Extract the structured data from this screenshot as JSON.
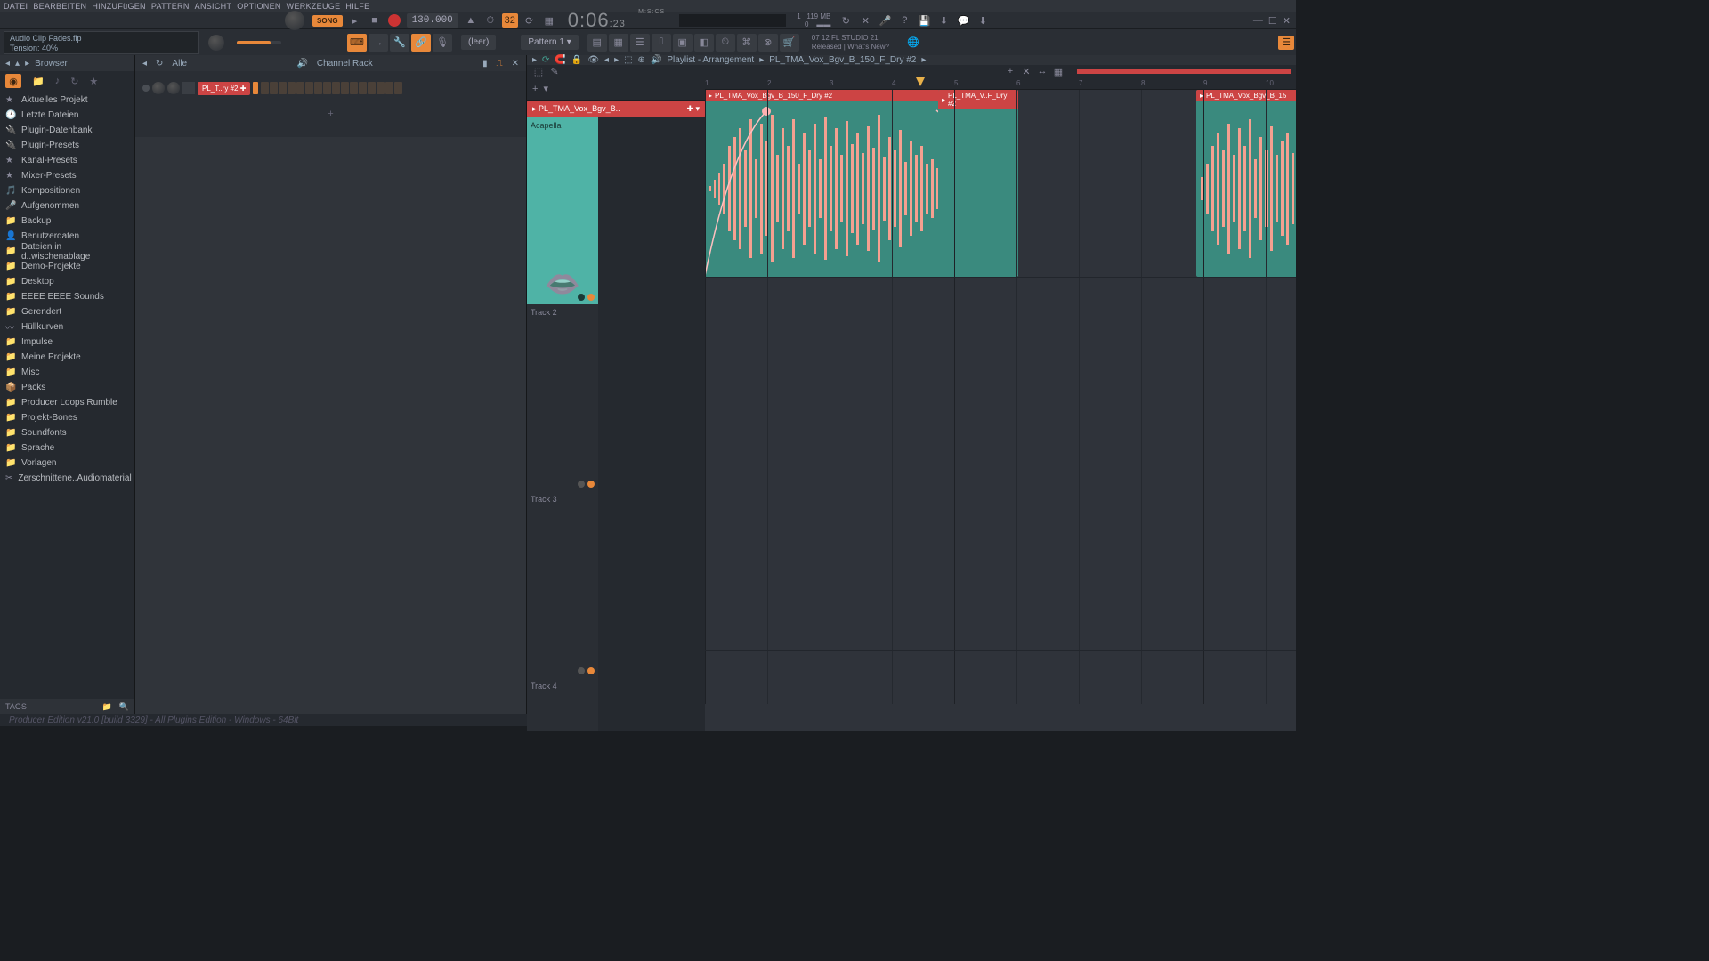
{
  "menu": [
    "DATEI",
    "BEARBEITEN",
    "HINZUFüGEN",
    "PATTERN",
    "ANSICHT",
    "OPTIONEN",
    "WERKZEUGE",
    "HILFE"
  ],
  "hint": {
    "line1": "Audio Clip Fades.flp",
    "line2": "Tension:  40%"
  },
  "transport": {
    "song_label": "SONG",
    "tempo": "130.000",
    "snap": "32",
    "time_main": "0:06",
    "time_sub": ":23",
    "time_unit": "M:S:CS"
  },
  "sys": {
    "voices": "1",
    "mem": "119 MB",
    "cpu": "0"
  },
  "info": {
    "line1": "07 12  FL STUDIO 21",
    "line2": "Released | What's New?"
  },
  "pattern": {
    "label": "Pattern 1",
    "dropdown_prefix": "(leer)"
  },
  "browser": {
    "title": "Browser",
    "filter": "Alle",
    "items": [
      {
        "icon": "★",
        "label": "Aktuelles Projekt"
      },
      {
        "icon": "🕐",
        "label": "Letzte Dateien"
      },
      {
        "icon": "🔌",
        "label": "Plugin-Datenbank"
      },
      {
        "icon": "🔌",
        "label": "Plugin-Presets"
      },
      {
        "icon": "★",
        "label": "Kanal-Presets"
      },
      {
        "icon": "★",
        "label": "Mixer-Presets"
      },
      {
        "icon": "🎵",
        "label": "Kompositionen"
      },
      {
        "icon": "🎤",
        "label": "Aufgenommen"
      },
      {
        "icon": "📁",
        "label": "Backup"
      },
      {
        "icon": "👤",
        "label": "Benutzerdaten"
      },
      {
        "icon": "📁",
        "label": "Dateien in d..wischenablage"
      },
      {
        "icon": "📁",
        "label": "Demo-Projekte"
      },
      {
        "icon": "📁",
        "label": "Desktop"
      },
      {
        "icon": "📁",
        "label": "EEEE EEEE Sounds"
      },
      {
        "icon": "📁",
        "label": "Gerendert"
      },
      {
        "icon": "〰",
        "label": "Hüllkurven"
      },
      {
        "icon": "📁",
        "label": "Impulse"
      },
      {
        "icon": "📁",
        "label": "Meine Projekte"
      },
      {
        "icon": "📁",
        "label": "Misc"
      },
      {
        "icon": "📦",
        "label": "Packs"
      },
      {
        "icon": "📁",
        "label": "Producer Loops Rumble"
      },
      {
        "icon": "📁",
        "label": "Projekt-Bones"
      },
      {
        "icon": "📁",
        "label": "Soundfonts"
      },
      {
        "icon": "📁",
        "label": "Sprache"
      },
      {
        "icon": "📁",
        "label": "Vorlagen"
      },
      {
        "icon": "✂",
        "label": "Zerschnittene..Audiomaterial"
      }
    ],
    "tags_label": "TAGS"
  },
  "channel_rack": {
    "title": "Channel Rack",
    "filter": "Alle",
    "channel_name": "PL_T..ry #2",
    "add": "+"
  },
  "playlist": {
    "title": "Playlist - Arrangement",
    "crumb": "PL_TMA_Vox_Bgv_B_150_F_Dry #2",
    "picker": "PL_TMA_Vox_Bgv_B..",
    "tracks": [
      "Acapella",
      "Track 2",
      "Track 3",
      "Track 4"
    ],
    "ruler": [
      "1",
      "2",
      "3",
      "4",
      "5",
      "6",
      "7",
      "8",
      "9",
      "10"
    ],
    "clips": [
      {
        "label": "PL_TMA_Vox_Bgv_B_150_F_Dry #2"
      },
      {
        "label": "PL_TMA_V..F_Dry #2"
      },
      {
        "label": "PL_TMA_Vox_Bgv_B_15"
      }
    ]
  },
  "status": "Producer Edition v21.0 [build 3329] - All Plugins Edition - Windows - 64Bit"
}
